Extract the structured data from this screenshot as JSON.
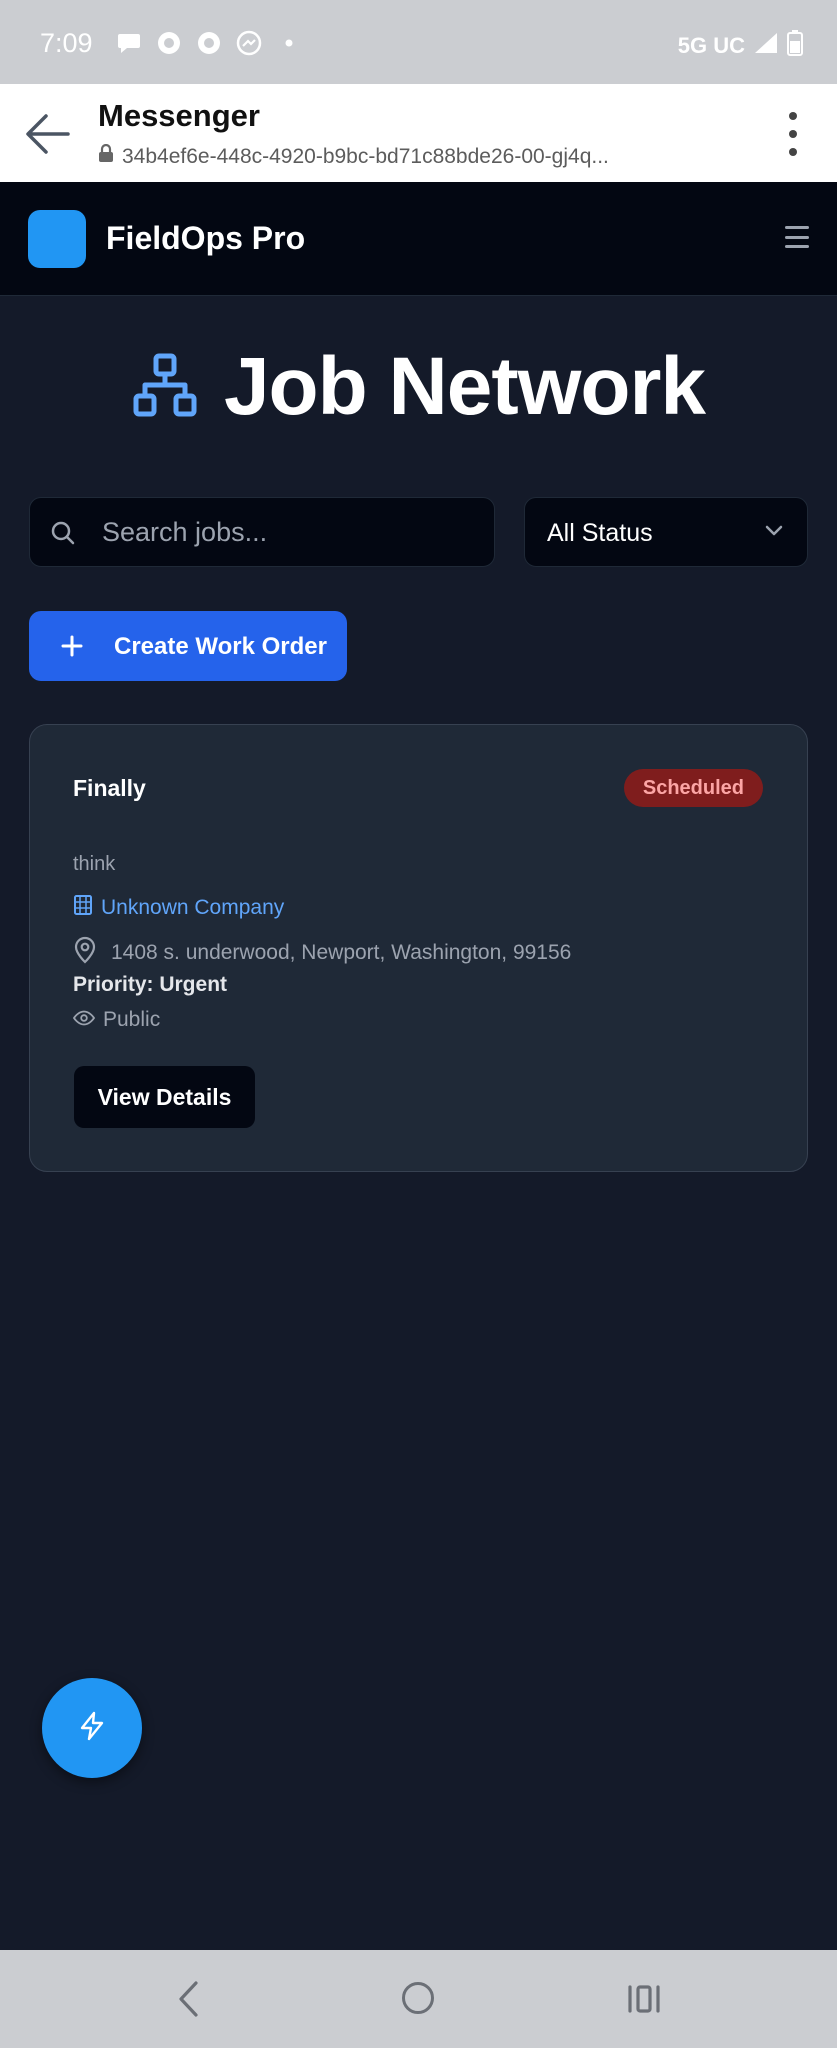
{
  "status_bar": {
    "time": "7:09",
    "network": "5G UC"
  },
  "browser": {
    "title": "Messenger",
    "url": "34b4ef6e-448c-4920-b9bc-bd71c88bde26-00-gj4q..."
  },
  "app": {
    "name": "FieldOps Pro",
    "brand_color": "#2196f3"
  },
  "page": {
    "title": "Job Network",
    "title_icon": "sitemap-icon"
  },
  "search": {
    "placeholder": "Search jobs...",
    "value": ""
  },
  "filter": {
    "selected": "All Status"
  },
  "actions": {
    "create_label": "Create Work Order"
  },
  "jobs": [
    {
      "title": "Finally",
      "status": "Scheduled",
      "description": "think",
      "company": "Unknown Company",
      "address": "1408 s. underwood, Newport, Washington, 99156",
      "priority": "Priority: Urgent",
      "visibility": "Public",
      "button_label": "View Details"
    }
  ],
  "colors": {
    "background": "#141a29",
    "card": "#1f2937",
    "accent": "#2563eb",
    "badge_bg": "#7f1d1d",
    "badge_text": "#fca5a5",
    "link": "#60a5fa"
  }
}
